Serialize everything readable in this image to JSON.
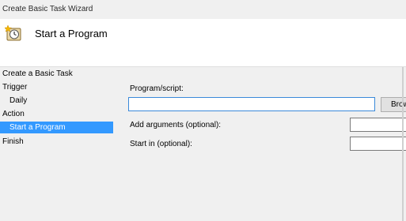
{
  "window": {
    "title": "Create Basic Task Wizard"
  },
  "header": {
    "icon": "task-clock-icon",
    "title": "Start a Program"
  },
  "nav": {
    "items": [
      {
        "label": "Create a Basic Task",
        "level": 0,
        "selected": false
      },
      {
        "label": "Trigger",
        "level": 0,
        "selected": false
      },
      {
        "label": "Daily",
        "level": 1,
        "selected": false
      },
      {
        "label": "Action",
        "level": 0,
        "selected": false
      },
      {
        "label": "Start a Program",
        "level": 1,
        "selected": true
      },
      {
        "label": "Finish",
        "level": 0,
        "selected": false
      }
    ]
  },
  "form": {
    "program_label": "Program/script:",
    "program_value": "",
    "browse_label": "Browse...",
    "arguments_label": "Add arguments (optional):",
    "arguments_value": "",
    "start_in_label": "Start in (optional):",
    "start_in_value": ""
  },
  "colors": {
    "selection": "#3399ff",
    "header_background": "#ffffff",
    "page_background": "#f0f0f0",
    "focus_border": "#3a89d9"
  }
}
